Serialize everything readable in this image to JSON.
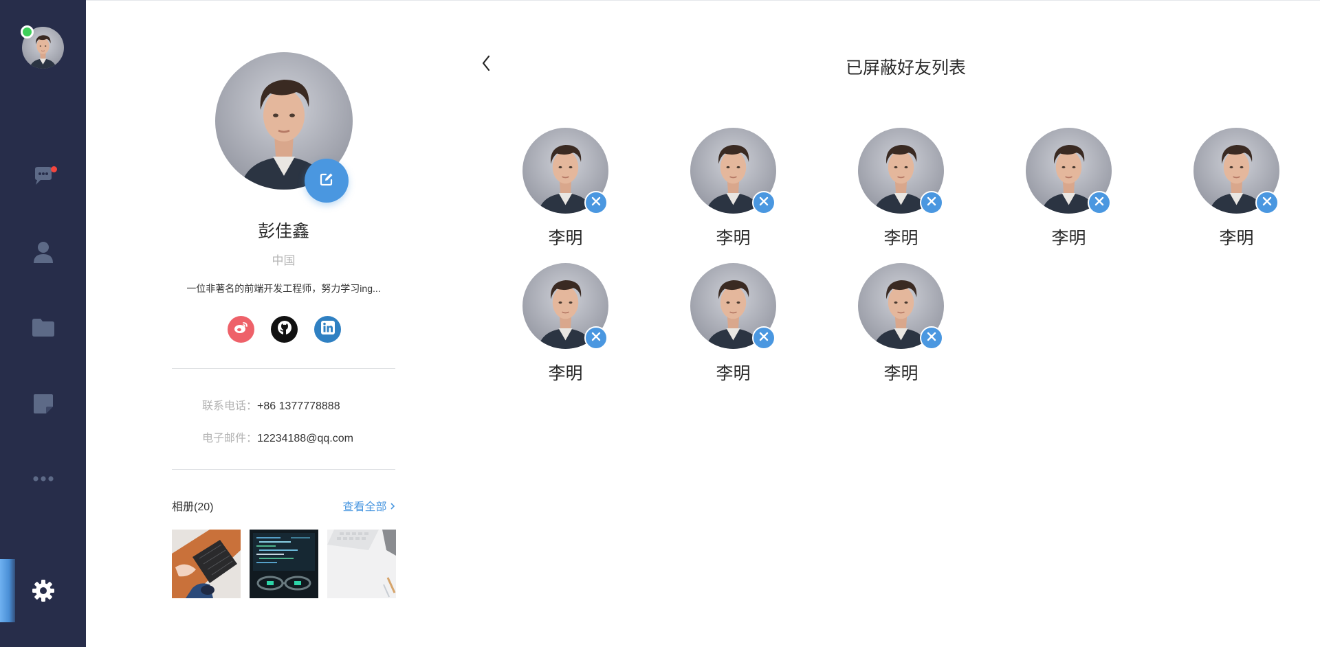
{
  "theme": {
    "sidebar_bg": "#272d4a",
    "accent": "#4a97e0",
    "online": "#3ed05a",
    "notify": "#f5463e"
  },
  "nav": {
    "items": [
      {
        "name": "chat",
        "icon": "chat-icon",
        "has_badge": true
      },
      {
        "name": "contacts",
        "icon": "user-icon",
        "has_badge": false
      },
      {
        "name": "files",
        "icon": "folder-icon",
        "has_badge": false
      },
      {
        "name": "notes",
        "icon": "note-icon",
        "has_badge": false
      },
      {
        "name": "more",
        "icon": "more-icon",
        "has_badge": false
      },
      {
        "name": "settings",
        "icon": "gear-icon",
        "active": true
      }
    ]
  },
  "profile": {
    "name": "彭佳鑫",
    "country": "中国",
    "bio": "一位非著名的前端开发工程师，努力学习ing...",
    "socials": [
      {
        "name": "weibo",
        "icon": "weibo-icon",
        "color": "#ee6169"
      },
      {
        "name": "github",
        "icon": "github-icon",
        "color": "#111111"
      },
      {
        "name": "linkedin",
        "icon": "linkedin-icon",
        "color": "#2f80c2"
      }
    ],
    "phone_label": "联系电话：",
    "phone": "+86 1377778888",
    "email_label": "电子邮件：",
    "email": "12234188@qq.com",
    "album_label": "相册(20)",
    "album_more": "查看全部",
    "album_more_icon": "chevron-right-icon",
    "photos": [
      "keyboard-desk-photo",
      "monitor-code-photo",
      "white-keyboard-photo"
    ]
  },
  "blocked": {
    "title": "已屏蔽好友列表",
    "back_icon": "chevron-left-icon",
    "friends": [
      {
        "name": "李明"
      },
      {
        "name": "李明"
      },
      {
        "name": "李明"
      },
      {
        "name": "李明"
      },
      {
        "name": "李明"
      },
      {
        "name": "李明"
      },
      {
        "name": "李明"
      },
      {
        "name": "李明"
      }
    ]
  }
}
